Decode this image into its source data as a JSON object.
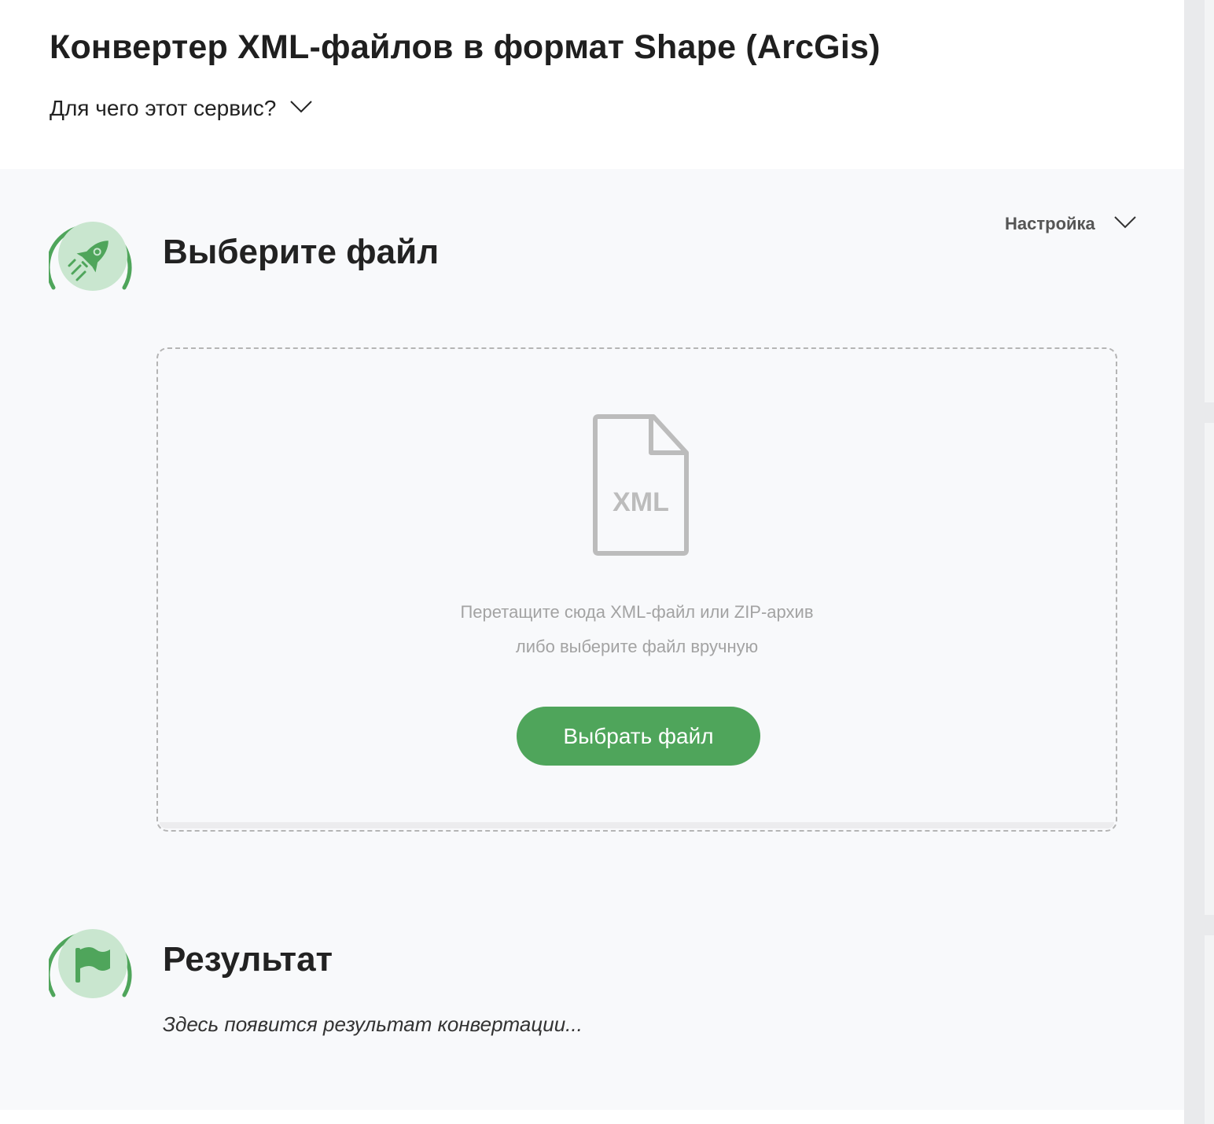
{
  "header": {
    "title": "Конвертер XML-файлов в формат Shape (ArcGis)",
    "faq_label": "Для чего этот сервис?"
  },
  "step_select": {
    "icon": "rocket-icon",
    "title": "Выберите файл",
    "settings_label": "Настройка",
    "dropzone": {
      "file_icon": "xml-file-icon",
      "file_icon_text": "XML",
      "hint_line1": "Перетащите сюда XML-файл или ZIP-архив",
      "hint_line2": "либо выберите файл вручную",
      "button_label": "Выбрать файл"
    }
  },
  "step_result": {
    "icon": "flag-icon",
    "title": "Результат",
    "placeholder": "Здесь появится результат конвертации..."
  },
  "colors": {
    "accent": "#4fa55b",
    "icon_bg": "#c9e6cf",
    "muted_text": "#a3a3a3",
    "panel_bg": "#f8f9fb"
  }
}
